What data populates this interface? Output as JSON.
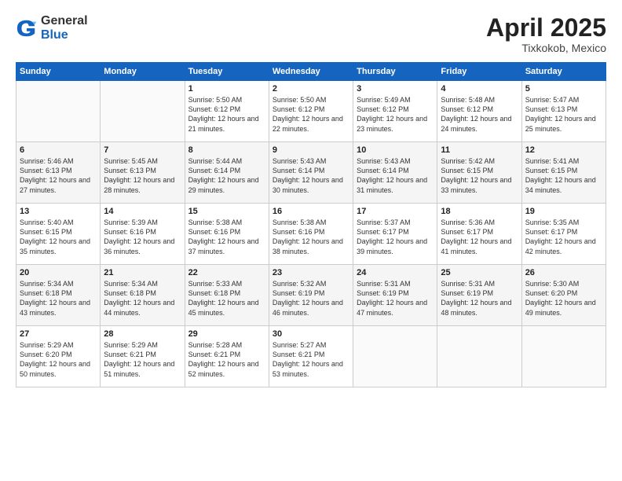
{
  "header": {
    "logo_general": "General",
    "logo_blue": "Blue",
    "title": "April 2025",
    "location": "Tixkokob, Mexico"
  },
  "days_of_week": [
    "Sunday",
    "Monday",
    "Tuesday",
    "Wednesday",
    "Thursday",
    "Friday",
    "Saturday"
  ],
  "weeks": [
    [
      {
        "day": "",
        "content": ""
      },
      {
        "day": "",
        "content": ""
      },
      {
        "day": "1",
        "content": "Sunrise: 5:50 AM\nSunset: 6:12 PM\nDaylight: 12 hours\nand 21 minutes."
      },
      {
        "day": "2",
        "content": "Sunrise: 5:50 AM\nSunset: 6:12 PM\nDaylight: 12 hours\nand 22 minutes."
      },
      {
        "day": "3",
        "content": "Sunrise: 5:49 AM\nSunset: 6:12 PM\nDaylight: 12 hours\nand 23 minutes."
      },
      {
        "day": "4",
        "content": "Sunrise: 5:48 AM\nSunset: 6:12 PM\nDaylight: 12 hours\nand 24 minutes."
      },
      {
        "day": "5",
        "content": "Sunrise: 5:47 AM\nSunset: 6:13 PM\nDaylight: 12 hours\nand 25 minutes."
      }
    ],
    [
      {
        "day": "6",
        "content": "Sunrise: 5:46 AM\nSunset: 6:13 PM\nDaylight: 12 hours\nand 27 minutes."
      },
      {
        "day": "7",
        "content": "Sunrise: 5:45 AM\nSunset: 6:13 PM\nDaylight: 12 hours\nand 28 minutes."
      },
      {
        "day": "8",
        "content": "Sunrise: 5:44 AM\nSunset: 6:14 PM\nDaylight: 12 hours\nand 29 minutes."
      },
      {
        "day": "9",
        "content": "Sunrise: 5:43 AM\nSunset: 6:14 PM\nDaylight: 12 hours\nand 30 minutes."
      },
      {
        "day": "10",
        "content": "Sunrise: 5:43 AM\nSunset: 6:14 PM\nDaylight: 12 hours\nand 31 minutes."
      },
      {
        "day": "11",
        "content": "Sunrise: 5:42 AM\nSunset: 6:15 PM\nDaylight: 12 hours\nand 33 minutes."
      },
      {
        "day": "12",
        "content": "Sunrise: 5:41 AM\nSunset: 6:15 PM\nDaylight: 12 hours\nand 34 minutes."
      }
    ],
    [
      {
        "day": "13",
        "content": "Sunrise: 5:40 AM\nSunset: 6:15 PM\nDaylight: 12 hours\nand 35 minutes."
      },
      {
        "day": "14",
        "content": "Sunrise: 5:39 AM\nSunset: 6:16 PM\nDaylight: 12 hours\nand 36 minutes."
      },
      {
        "day": "15",
        "content": "Sunrise: 5:38 AM\nSunset: 6:16 PM\nDaylight: 12 hours\nand 37 minutes."
      },
      {
        "day": "16",
        "content": "Sunrise: 5:38 AM\nSunset: 6:16 PM\nDaylight: 12 hours\nand 38 minutes."
      },
      {
        "day": "17",
        "content": "Sunrise: 5:37 AM\nSunset: 6:17 PM\nDaylight: 12 hours\nand 39 minutes."
      },
      {
        "day": "18",
        "content": "Sunrise: 5:36 AM\nSunset: 6:17 PM\nDaylight: 12 hours\nand 41 minutes."
      },
      {
        "day": "19",
        "content": "Sunrise: 5:35 AM\nSunset: 6:17 PM\nDaylight: 12 hours\nand 42 minutes."
      }
    ],
    [
      {
        "day": "20",
        "content": "Sunrise: 5:34 AM\nSunset: 6:18 PM\nDaylight: 12 hours\nand 43 minutes."
      },
      {
        "day": "21",
        "content": "Sunrise: 5:34 AM\nSunset: 6:18 PM\nDaylight: 12 hours\nand 44 minutes."
      },
      {
        "day": "22",
        "content": "Sunrise: 5:33 AM\nSunset: 6:18 PM\nDaylight: 12 hours\nand 45 minutes."
      },
      {
        "day": "23",
        "content": "Sunrise: 5:32 AM\nSunset: 6:19 PM\nDaylight: 12 hours\nand 46 minutes."
      },
      {
        "day": "24",
        "content": "Sunrise: 5:31 AM\nSunset: 6:19 PM\nDaylight: 12 hours\nand 47 minutes."
      },
      {
        "day": "25",
        "content": "Sunrise: 5:31 AM\nSunset: 6:19 PM\nDaylight: 12 hours\nand 48 minutes."
      },
      {
        "day": "26",
        "content": "Sunrise: 5:30 AM\nSunset: 6:20 PM\nDaylight: 12 hours\nand 49 minutes."
      }
    ],
    [
      {
        "day": "27",
        "content": "Sunrise: 5:29 AM\nSunset: 6:20 PM\nDaylight: 12 hours\nand 50 minutes."
      },
      {
        "day": "28",
        "content": "Sunrise: 5:29 AM\nSunset: 6:21 PM\nDaylight: 12 hours\nand 51 minutes."
      },
      {
        "day": "29",
        "content": "Sunrise: 5:28 AM\nSunset: 6:21 PM\nDaylight: 12 hours\nand 52 minutes."
      },
      {
        "day": "30",
        "content": "Sunrise: 5:27 AM\nSunset: 6:21 PM\nDaylight: 12 hours\nand 53 minutes."
      },
      {
        "day": "",
        "content": ""
      },
      {
        "day": "",
        "content": ""
      },
      {
        "day": "",
        "content": ""
      }
    ]
  ]
}
